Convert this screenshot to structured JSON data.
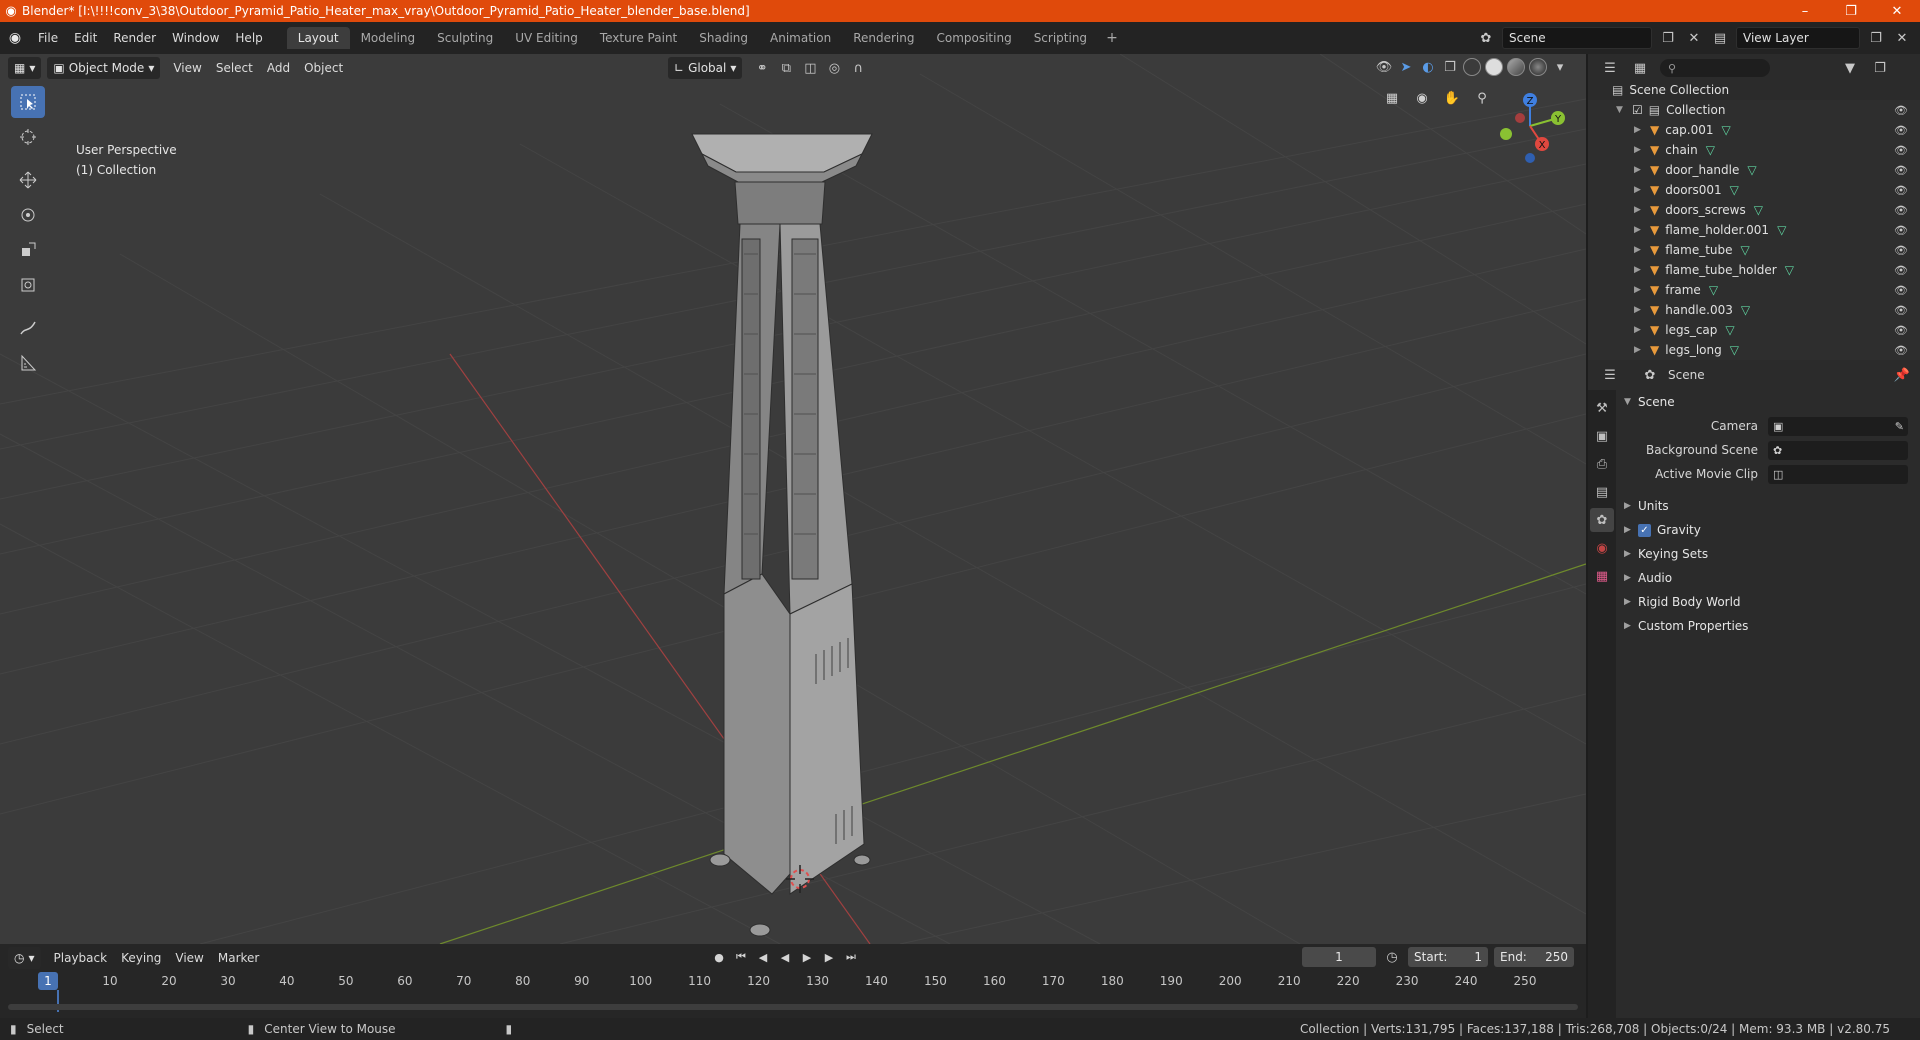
{
  "window": {
    "title": "Blender* [I:\\!!!!conv_3\\38\\Outdoor_Pyramid_Patio_Heater_max_vray\\Outdoor_Pyramid_Patio_Heater_blender_base.blend]"
  },
  "menus": [
    "File",
    "Edit",
    "Render",
    "Window",
    "Help"
  ],
  "workspaces": [
    "Layout",
    "Modeling",
    "Sculpting",
    "UV Editing",
    "Texture Paint",
    "Shading",
    "Animation",
    "Rendering",
    "Compositing",
    "Scripting"
  ],
  "active_workspace": "Layout",
  "scene_field": "Scene",
  "view_layer_field": "View Layer",
  "viewport": {
    "mode": "Object Mode",
    "menus": [
      "View",
      "Select",
      "Add",
      "Object"
    ],
    "transform_orientation": "Global",
    "info_line1": "User Perspective",
    "info_line2": "(1) Collection"
  },
  "gizmo": {
    "x": "X",
    "y": "Y",
    "z": "Z"
  },
  "timeline": {
    "menus": [
      "Playback",
      "Keying",
      "View",
      "Marker"
    ],
    "current_frame": "1",
    "start_label": "Start:",
    "start": "1",
    "end_label": "End:",
    "end": "250",
    "ticks": [
      "10",
      "20",
      "30",
      "40",
      "50",
      "60",
      "70",
      "80",
      "90",
      "100",
      "110",
      "120",
      "130",
      "140",
      "150",
      "160",
      "170",
      "180",
      "190",
      "200",
      "210",
      "220",
      "230",
      "240",
      "250"
    ],
    "playhead_label": "1"
  },
  "status": {
    "left": "Select",
    "middle": "Center View to Mouse",
    "stats": "Collection | Verts:131,795 | Faces:137,188 | Tris:268,708 | Objects:0/24 | Mem: 93.3 MB | v2.80.75"
  },
  "outliner": {
    "root": "Scene Collection",
    "collection": "Collection",
    "objects": [
      "cap.001",
      "chain",
      "door_handle",
      "doors001",
      "doors_screws",
      "flame_holder.001",
      "flame_tube",
      "flame_tube_holder",
      "frame",
      "handle.003",
      "legs_cap",
      "legs_long"
    ]
  },
  "properties": {
    "context": "Scene",
    "panel": "Scene",
    "rows": [
      {
        "label": "Camera"
      },
      {
        "label": "Background Scene"
      },
      {
        "label": "Active Movie Clip"
      }
    ],
    "subpanels": [
      "Units",
      "Gravity",
      "Keying Sets",
      "Audio",
      "Rigid Body World",
      "Custom Properties"
    ]
  },
  "colors": {
    "titlebar": "#e04a0b",
    "accent": "#4772b3",
    "x_axis": "#e0483f",
    "y_axis": "#8ac132",
    "z_axis": "#3f7fe0"
  }
}
